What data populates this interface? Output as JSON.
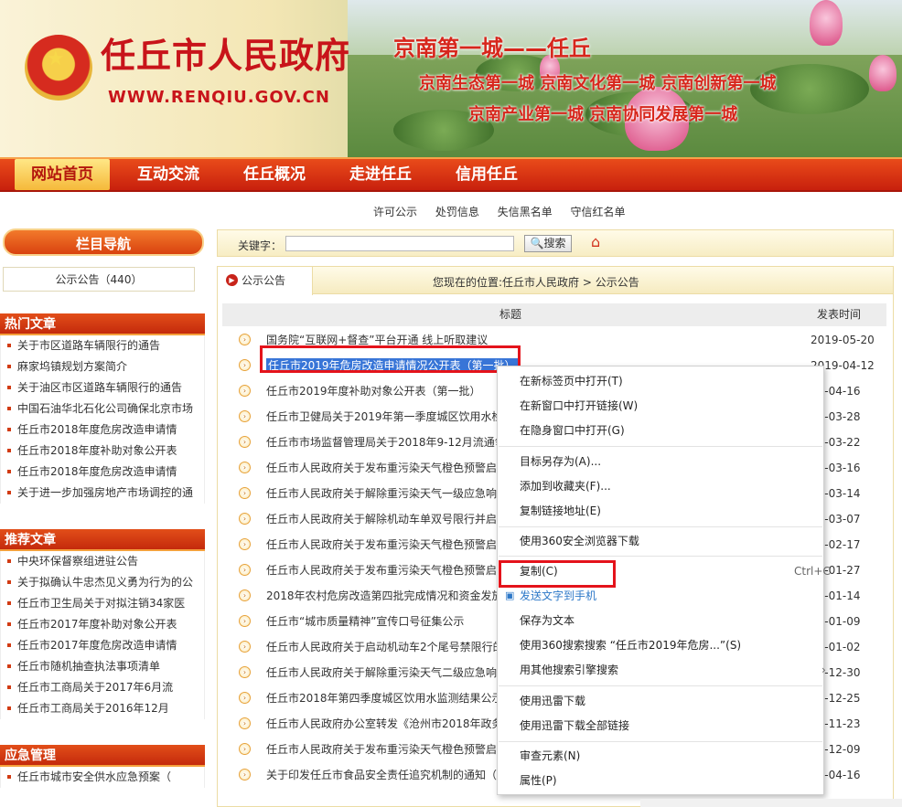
{
  "header": {
    "site_title": "任丘市人民政府",
    "site_url": "WWW.RENQIU.GOV.CN",
    "slogan_main": "京南第一城——任丘",
    "slogan_line2": "京南生态第一城  京南文化第一城  京南创新第一城",
    "slogan_line3": "京南产业第一城  京南协同发展第一城"
  },
  "nav": {
    "items": [
      "网站首页",
      "互动交流",
      "任丘概况",
      "走进任丘",
      "信用任丘"
    ]
  },
  "subnav": [
    "许可公示",
    "处罚信息",
    "失信黑名单",
    "守信红名单"
  ],
  "sidebar": {
    "nav_title": "栏目导航",
    "nav_item": "公示公告（440）",
    "hot_title": "热门文章",
    "hot": [
      "关于市区道路车辆限行的通告",
      "麻家坞镇规划方案简介",
      "关于油区市区道路车辆限行的通告",
      "中国石油华北石化公司确保北京市场",
      "任丘市2018年度危房改造申请情",
      "任丘市2018年度补助对象公开表",
      "任丘市2018年度危房改造申请情",
      "关于进一步加强房地产市场调控的通"
    ],
    "rec_title": "推荐文章",
    "rec": [
      "中央环保督察组进驻公告",
      "关于拟确认牛忠杰见义勇为行为的公",
      "任丘市卫生局关于对拟注销34家医",
      "任丘市2017年度补助对象公开表",
      "任丘市2017年度危房改造申请情",
      "任丘市随机抽查执法事项清单",
      "任丘市工商局关于2017年6月流",
      "任丘市工商局关于2016年12月"
    ],
    "emg_title": "应急管理",
    "emg": [
      "任丘市城市安全供水应急预案（"
    ]
  },
  "search": {
    "label": "关键字：",
    "button": "搜索"
  },
  "list": {
    "tab": "公示公告",
    "breadcrumb": "您现在的位置:任丘市人民政府 > 公示公告",
    "col_title": "标题",
    "col_date": "发表时间",
    "rows": [
      {
        "title": "国务院“互联网+督查”平台开通 线上听取建议",
        "date": "2019-05-20"
      },
      {
        "title": "任丘市2019年危房改造申请情况公开表（第一批）",
        "date": "2019-04-12"
      },
      {
        "title": "任丘市2019年度补助对象公开表（第一批）",
        "date": "19-04-16"
      },
      {
        "title": "任丘市卫健局关于2019年第一季度城区饮用水检",
        "date": "19-03-28"
      },
      {
        "title": "任丘市市场监督管理局关于2018年9-12月流通领",
        "date": "19-03-22"
      },
      {
        "title": "任丘市人民政府关于发布重污染天气橙色预警启",
        "date": "19-03-16"
      },
      {
        "title": "任丘市人民政府关于解除重污染天气一级应急响",
        "date": "19-03-14"
      },
      {
        "title": "任丘市人民政府关于解除机动车单双号限行并启",
        "date": "19-03-07"
      },
      {
        "title": "任丘市人民政府关于发布重污染天气橙色预警启",
        "date": "19-02-17"
      },
      {
        "title": "任丘市人民政府关于发布重污染天气橙色预警启",
        "date": "19-01-27"
      },
      {
        "title": "2018年农村危房改造第四批完成情况和资金发放",
        "date": "19-01-14"
      },
      {
        "title": "任丘市“城市质量精神”宣传口号征集公示",
        "date": "19-01-09"
      },
      {
        "title": "任丘市人民政府关于启动机动车2个尾号禁限行的",
        "date": "19-01-02"
      },
      {
        "title": "任丘市人民政府关于解除重污染天气二级应急响",
        "date": "18-12-30"
      },
      {
        "title": "任丘市2018年第四季度城区饮用水监测结果公示",
        "date": "18-12-25"
      },
      {
        "title": "任丘市人民政府办公室转发《沧州市2018年政务",
        "date": "18-11-23"
      },
      {
        "title": "任丘市人民政府关于发布重污染天气橙色预警启",
        "date": "18-12-09"
      },
      {
        "title": "关于印发任丘市食品安全责任追究机制的通知（",
        "date": "13-04-16"
      }
    ]
  },
  "context_menu": {
    "items": [
      "在新标签页中打开(T)",
      "在新窗口中打开链接(W)",
      "在隐身窗口中打开(G)",
      "目标另存为(A)...",
      "添加到收藏夹(F)...",
      "复制链接地址(E)",
      "使用360安全浏览器下载",
      "复制(C)",
      "发送文字到手机",
      "保存为文本",
      "使用360搜索搜索 “任丘市2019年危房...”(S)",
      "用其他搜索引擎搜索",
      "使用迅雷下载",
      "使用迅雷下载全部链接",
      "审查元素(N)",
      "属性(P)"
    ],
    "copy_shortcut": "Ctrl+C"
  },
  "colors": {
    "brand_red": "#c8141a",
    "highlight_box": "#e4131b",
    "selection": "#3875d7"
  }
}
